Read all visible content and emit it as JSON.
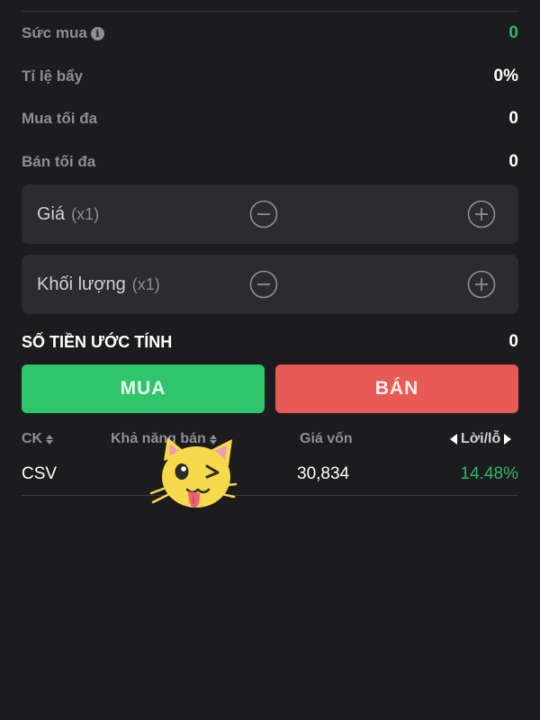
{
  "account": {
    "buying_power": {
      "label": "Sức mua",
      "value": "0",
      "value_color": "#30b567",
      "icon": "info-icon"
    },
    "leverage": {
      "label": "Tỉ lệ bẩy",
      "value": "0%"
    },
    "max_buy": {
      "label": "Mua tối đa",
      "value": "0"
    },
    "max_sell": {
      "label": "Bán tối đa",
      "value": "0"
    }
  },
  "price_input": {
    "label": "Giá",
    "multiplier": "(x1)",
    "minus_icon": "minus-circle-icon",
    "plus_icon": "plus-circle-icon"
  },
  "volume_input": {
    "label": "Khối lượng",
    "multiplier": "(x1)",
    "minus_icon": "minus-circle-icon",
    "plus_icon": "plus-circle-icon"
  },
  "estimate": {
    "label": "SỐ TIỀN ƯỚC TÍNH",
    "value": "0"
  },
  "actions": {
    "buy_label": "MUA",
    "sell_label": "BÁN",
    "buy_color": "#2fc56b",
    "sell_color": "#e85a55"
  },
  "holdings": {
    "columns": {
      "symbol": "CK",
      "sellable": "Khả năng bán",
      "cost_price": "Giá vốn",
      "profit_loss": "Lời/lỗ"
    },
    "rows": [
      {
        "symbol": "CSV",
        "sellable": "",
        "cost_price": "30,834",
        "profit_loss": "14.48%"
      }
    ]
  },
  "overlay": {
    "sticker": "winking-cat-sticker"
  }
}
